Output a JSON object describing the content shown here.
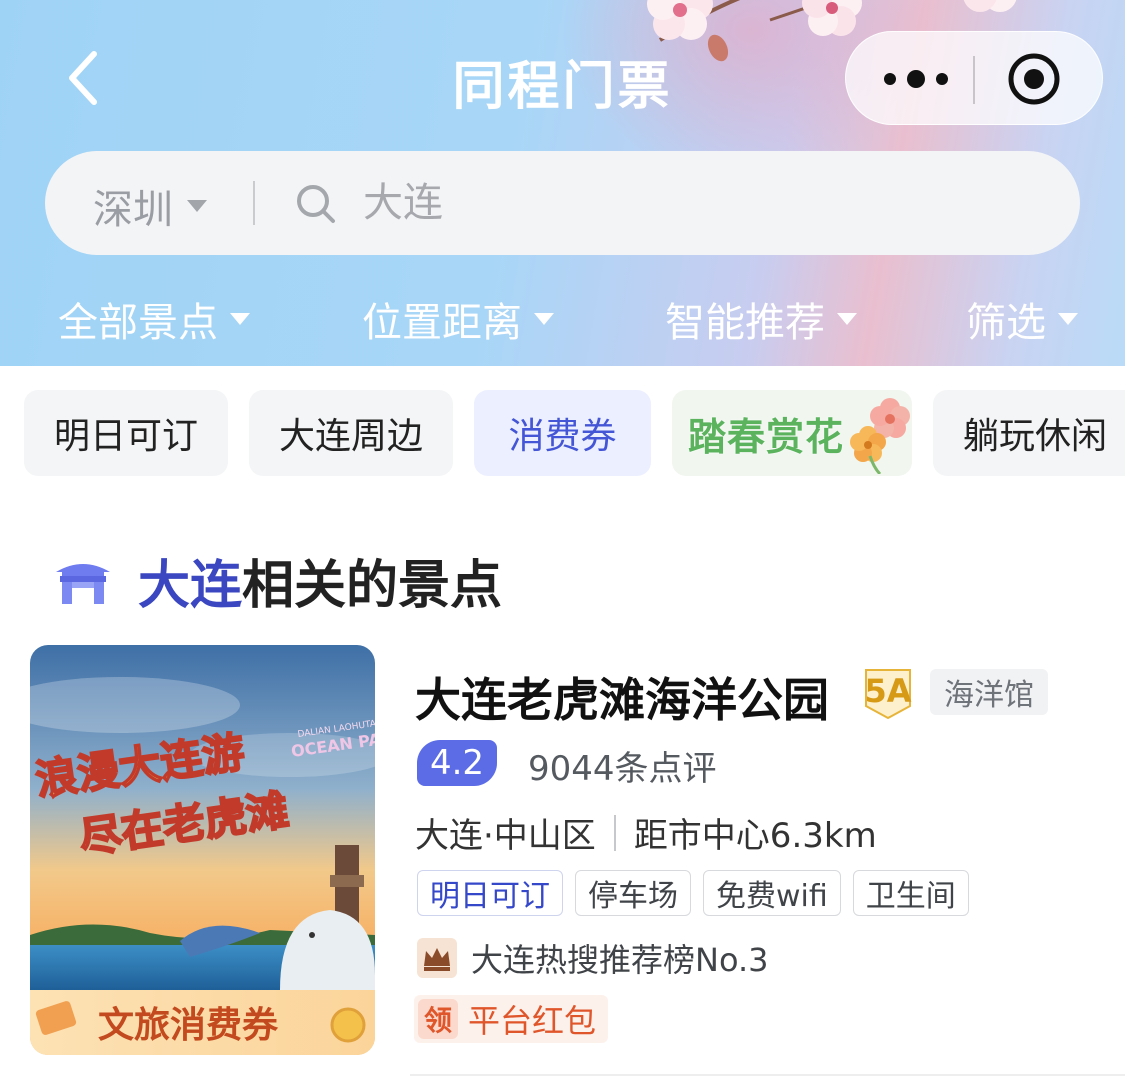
{
  "nav": {
    "title": "同程门票",
    "back_icon": "chevron-left-icon",
    "more_icon": "more-dots-icon",
    "close_icon": "target-circle-icon"
  },
  "search": {
    "city": "深圳",
    "placeholder": "大连",
    "icon": "search-icon"
  },
  "filters": [
    {
      "label": "全部景点"
    },
    {
      "label": "位置距离"
    },
    {
      "label": "智能推荐"
    },
    {
      "label": "筛选"
    }
  ],
  "chips": [
    {
      "label": "明日可订"
    },
    {
      "label": "大连周边"
    },
    {
      "label": "消费券",
      "active": true
    },
    {
      "label": "踏春赏花"
    },
    {
      "label": "躺玩休闲"
    }
  ],
  "section": {
    "highlight": "大连",
    "rest": "相关的景点",
    "icon": "temple-icon"
  },
  "poi": {
    "title": "大连老虎滩海洋公园",
    "level_badge": "5A",
    "type_tag": "海洋馆",
    "rating": "4.2",
    "reviews": "9044条点评",
    "location": "大连·中山区",
    "distance": "距市中心6.3km",
    "feature_tags": [
      "明日可订",
      "停车场",
      "免费wifi",
      "卫生间"
    ],
    "rank": "大连热搜推荐榜No.3",
    "coupon_badge": "领",
    "coupon": "平台红包",
    "image": {
      "line1": "浪漫大连游",
      "line2": "尽在老虎滩",
      "en_small": "DALIAN LAOHUTAN",
      "en_big": "OCEAN PARK",
      "banner": "文旅消费券"
    }
  },
  "colors": {
    "accent": "#3a47c0",
    "active_chip_bg": "#ebefff",
    "rating_bg": "#5b6ce6",
    "coupon": "#e0562b",
    "badge_gold": "#d79a17"
  }
}
